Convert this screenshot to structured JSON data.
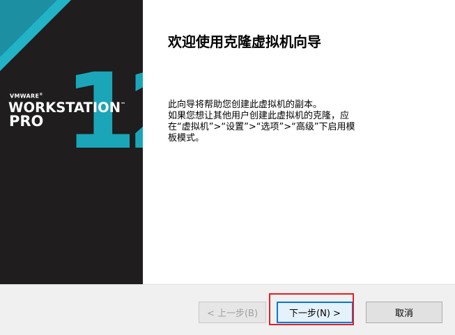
{
  "brand": {
    "company": "VMWARE",
    "product": "WORKSTATION",
    "edition": "PRO",
    "version": "12",
    "accent_color": "#1aa6b8",
    "panel_color": "#1f1d1d"
  },
  "page": {
    "title": "欢迎使用克隆虚拟机向导",
    "description": [
      "此向导将帮助您创建此虚拟机的副本。",
      "如果您想让其他用户创建此虚拟机的克隆，应在“虚拟机”>“设置”>“选项”>“高级”下启用模板模式。"
    ]
  },
  "footer": {
    "back_label": "< 上一步(B)",
    "next_label": "下一步(N) >",
    "cancel_label": "取消"
  },
  "highlight": {
    "target": "next-button",
    "color": "#e31e24"
  }
}
